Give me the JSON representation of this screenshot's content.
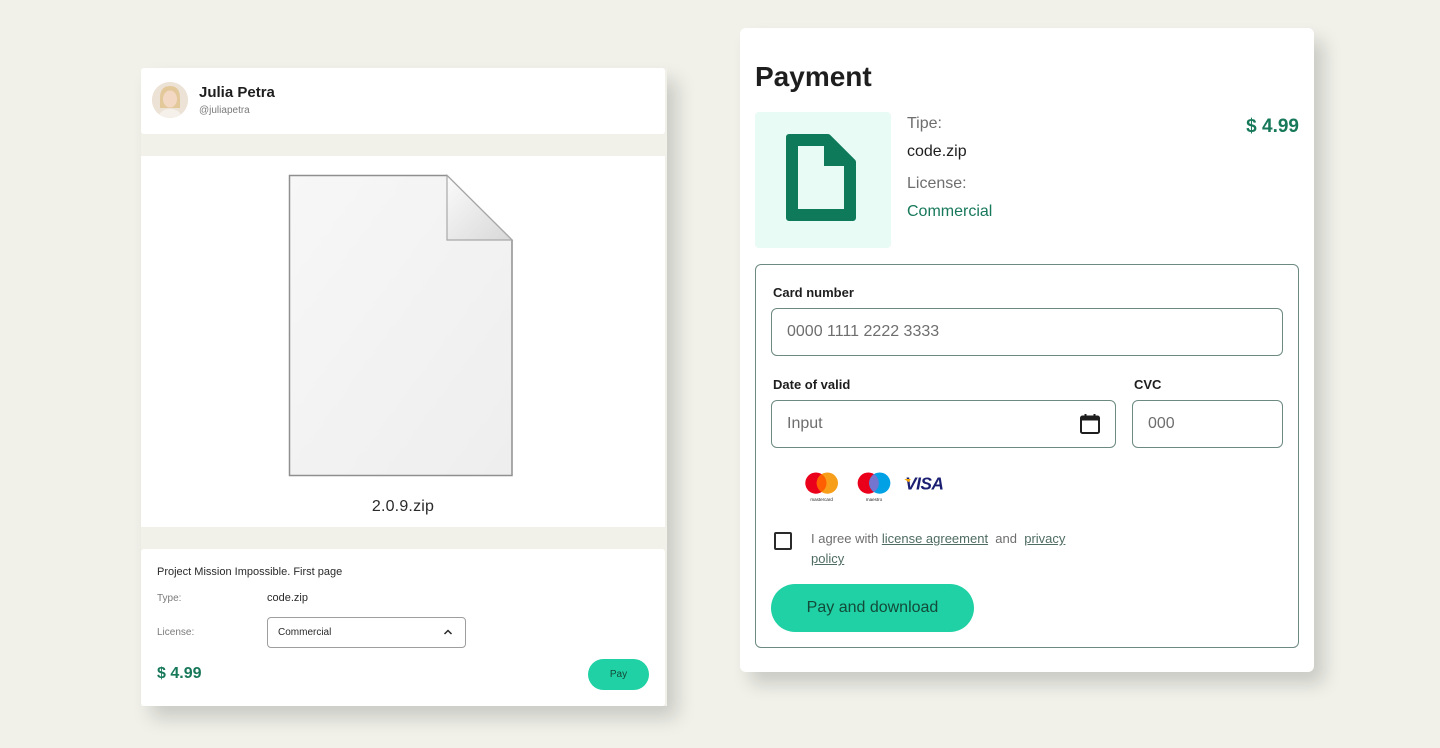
{
  "left_card": {
    "user": {
      "name": "Julia Petra",
      "handle": "@juliapetra"
    },
    "preview": {
      "file_name": "2.0.9.zip"
    },
    "details": {
      "project_title": "Project Mission Impossible. First page",
      "type_label": "Type:",
      "type_value": "code.zip",
      "license_label": "License:",
      "license_value": "Commercial",
      "price": "$ 4.99",
      "pay_label": "Pay"
    }
  },
  "payment": {
    "title": "Payment",
    "type_label": "Tipe:",
    "type_value": "code.zip",
    "license_label": "License:",
    "license_value": "Commercial",
    "price": "$ 4.99",
    "card_number_label": "Card number",
    "card_number_placeholder": "0000 1111 2222 3333",
    "date_label": "Date of valid",
    "date_placeholder": "Input",
    "cvc_label": "CVC",
    "cvc_placeholder": "000",
    "logos": {
      "mastercard": "mastercard",
      "maestro": "maestro",
      "visa": "VISA"
    },
    "agree_prefix": "I agree with",
    "license_link": "license agreement",
    "and_text": "and",
    "privacy_link": "privacy policy",
    "pay_button": "Pay and download"
  },
  "colors": {
    "background": "#f1f1ea",
    "accent": "#1fd1a4",
    "price_green": "#17785a",
    "thumb_bg": "#e8fbf5",
    "mastercard_red": "#eb001b",
    "mastercard_orange": "#f79e1b",
    "maestro_blue": "#00a2e5",
    "visa_blue": "#1a1f71"
  },
  "icons": [
    "document-icon",
    "calendar-icon",
    "chevron-up-icon",
    "generic-file-icon"
  ]
}
